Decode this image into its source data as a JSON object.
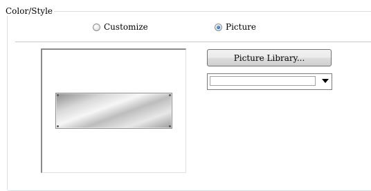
{
  "group": {
    "title": "Color/Style"
  },
  "options": {
    "customize_label": "Customize",
    "customize_selected": false,
    "picture_label": "Picture",
    "picture_selected": true
  },
  "picture_library_button": "Picture Library...",
  "picture_select": {
    "value": ""
  },
  "icons": {
    "dropdown": "chevron-down-icon",
    "radio": "radio-icon"
  },
  "colors": {
    "group_border": "#d5dfe5",
    "radio_dot": "#1e5fb8"
  }
}
